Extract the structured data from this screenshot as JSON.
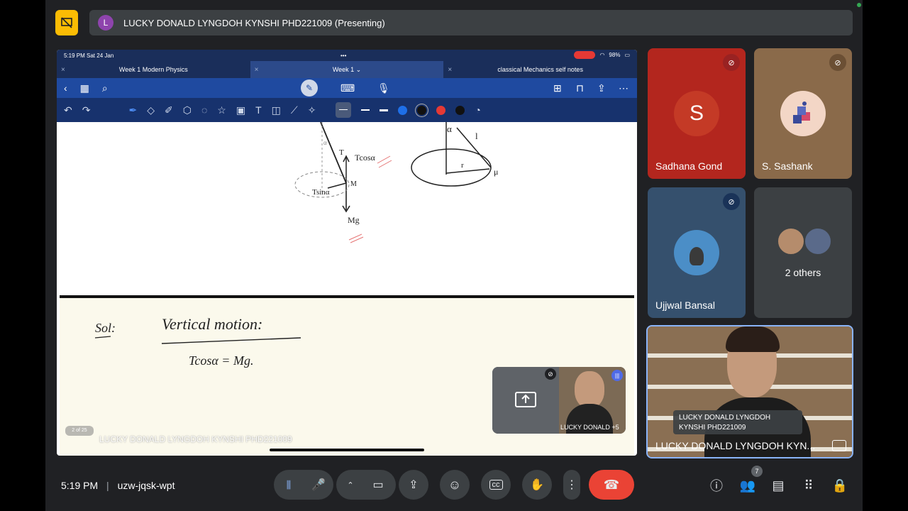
{
  "topbar": {
    "presenter_initial": "L",
    "presenting_text": "LUCKY DONALD LYNGDOH KYNSHI PHD221009 (Presenting)"
  },
  "ipad": {
    "time_date": "5:19 PM  Sat 24 Jan",
    "battery": "98%",
    "tabs": [
      "Week 1 Modern Physics",
      "Week 1 ⌄",
      "classical Mechanics self notes"
    ]
  },
  "notes": {
    "labels_top": [
      "α",
      "T",
      "Tcosα",
      "Tsinα",
      "M",
      "Mg",
      "l",
      "r",
      "μ"
    ],
    "sol": "Sol:",
    "heading": "Vertical motion:",
    "equation": "Tcosα = Mg."
  },
  "stage": {
    "page_indicator": "2 of 25",
    "watermark": "LUCKY DONALD LYNGDOH KYNSHI PHD221009",
    "pip_name": "LUCKY DONALD +5"
  },
  "participants": [
    {
      "name": "Sadhana Gond",
      "initial": "S",
      "bg": "#b3261e"
    },
    {
      "name": "S. Sashank",
      "bg": "#8a6a4a"
    },
    {
      "name": "Ujjwal Bansal",
      "bg": "#35506d"
    },
    {
      "name": "2 others",
      "bg": "#3c4043"
    }
  ],
  "active_speaker": {
    "tooltip_line1": "LUCKY DONALD LYNGDOH",
    "tooltip_line2": "KYNSHI PHD221009",
    "name": "LUCKY DONALD LYNGDOH KYN..."
  },
  "bottom": {
    "time": "5:19 PM",
    "meeting_code": "uzw-jqsk-wpt",
    "people_count": "7"
  },
  "colors": {
    "accent_yellow": "#fbbc04",
    "end_call": "#ea4335",
    "toolbar_blue": "#1f4aa0"
  }
}
